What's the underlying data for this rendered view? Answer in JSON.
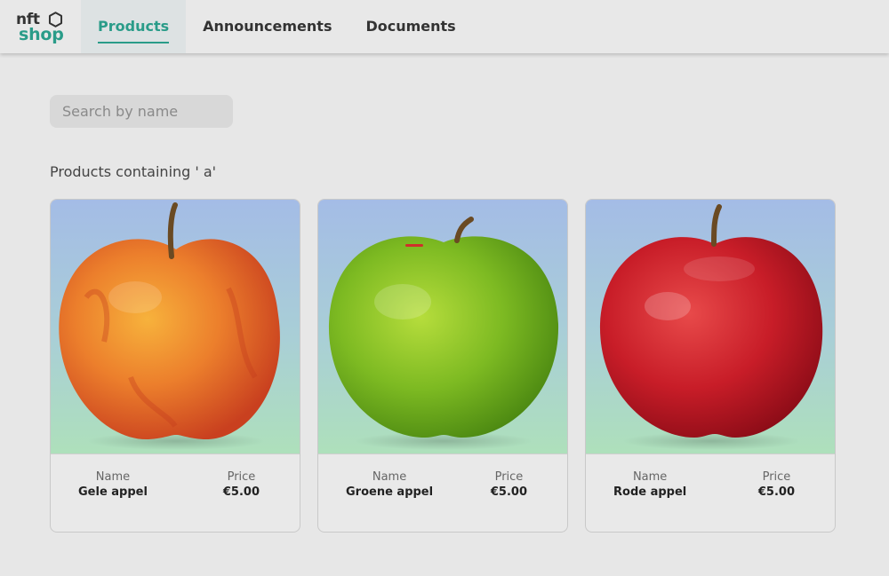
{
  "brand": {
    "line1": "nft",
    "line2": "shop",
    "accent_color": "#2a9c89"
  },
  "nav": {
    "items": [
      {
        "label": "Products",
        "active": true
      },
      {
        "label": "Announcements",
        "active": false
      },
      {
        "label": "Documents",
        "active": false
      }
    ]
  },
  "search": {
    "placeholder": "Search by name",
    "value": ""
  },
  "results": {
    "heading": "Products containing ' a'"
  },
  "product_fields": {
    "name_label": "Name",
    "price_label": "Price"
  },
  "products": [
    {
      "name": "Gele appel",
      "price": "€5.00",
      "image": "yellow-red-apple"
    },
    {
      "name": "Groene appel",
      "price": "€5.00",
      "image": "green-apple"
    },
    {
      "name": "Rode appel",
      "price": "€5.00",
      "image": "red-apple"
    }
  ]
}
